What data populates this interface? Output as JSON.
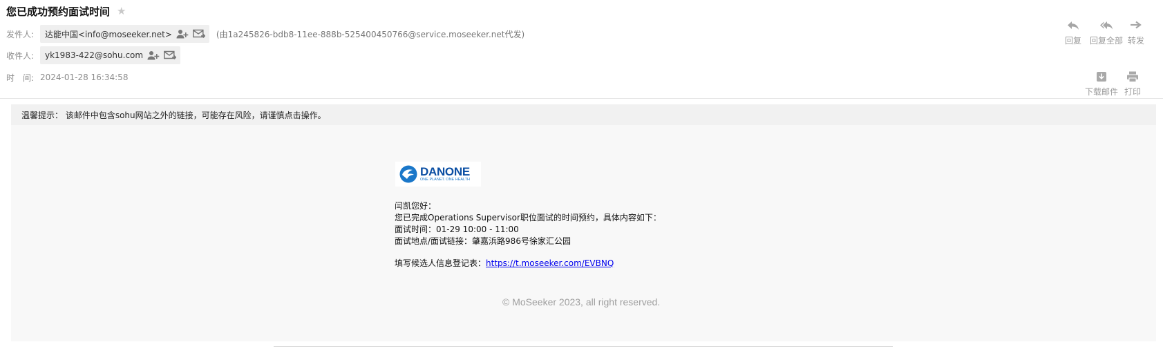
{
  "header": {
    "subject": "您已成功预约面试时间",
    "from_label": "发件人:",
    "from_name": "达能中国<info@moseeker.net>",
    "via_text": "(由1a245826-bdb8-11ee-888b-525400450766@service.moseeker.net代发)",
    "to_label": "收件人:",
    "to_address": "yk1983-422@sohu.com",
    "time_label": "时　间:",
    "time_value": "2024-01-28 16:34:58"
  },
  "actions": {
    "reply": "回复",
    "reply_all": "回复全部",
    "forward": "转发",
    "download": "下载邮件",
    "print": "打印"
  },
  "icons": {
    "star": "star-icon",
    "add_contact": "add-contact-icon",
    "send_mail": "mail-icon",
    "reply": "reply-icon",
    "reply_all": "reply-all-icon",
    "forward": "forward-icon",
    "download": "download-icon",
    "print": "print-icon"
  },
  "warning": "温馨提示： 该邮件中包含sohu网站之外的链接，可能存在风险，请谨慎点击操作。",
  "mail": {
    "logo_word": "DANONE",
    "logo_tagline": "ONE PLANET. ONE HEALTH",
    "greeting": "闫凯您好：",
    "line1": "您已完成Operations Supervisor职位面试的时间预约，具体内容如下：",
    "line2": "面试时间：01-29 10:00 - 11:00",
    "line3": "面试地点/面试链接：肇嘉浜路986号徐家汇公园",
    "form_label": "填写候选人信息登记表：",
    "form_link": "https://t.moseeker.com/EVBNQ",
    "copyright": "© MoSeeker 2023, all right reserved."
  },
  "colors": {
    "link": "#0000ee",
    "brand_blue": "#0a4ea3",
    "chip_bg": "#efefef",
    "icon_gray": "#9a9a9a"
  }
}
